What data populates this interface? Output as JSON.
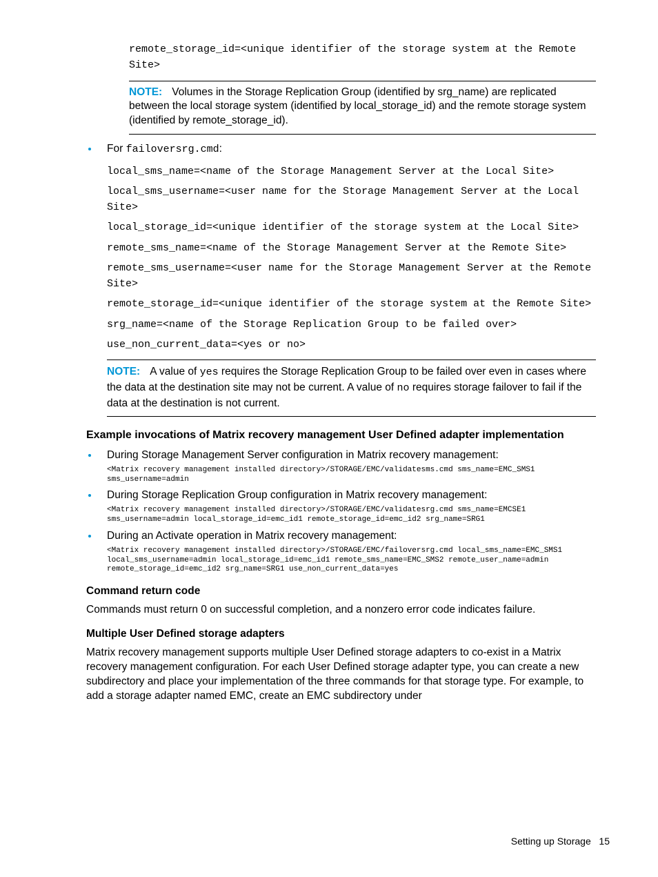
{
  "top_code": "remote_storage_id=<unique identifier of the storage system at the Remote Site>",
  "note1": {
    "label": "NOTE:",
    "text": "Volumes in the Storage Replication Group (identified by srg_name) are replicated between the local storage system (identified by local_storage_id) and the remote storage system (identified by remote_storage_id)."
  },
  "bullet1_prefix": "For ",
  "bullet1_code": "failoversrg.cmd",
  "bullet1_suffix": ":",
  "failover_lines": [
    "local_sms_name=<name of the Storage Management Server at the Local Site>",
    "local_sms_username=<user name for the Storage Management Server at the Local Site>",
    "local_storage_id=<unique identifier of the storage system at the Local Site>",
    "remote_sms_name=<name of the Storage Management Server at the Remote Site>",
    "remote_sms_username=<user name for the Storage Management Server at the Remote Site>",
    "remote_storage_id=<unique identifier of the storage system at the Remote Site>",
    "srg_name=<name of the Storage Replication Group to be failed over>",
    "use_non_current_data=<yes or no>"
  ],
  "note2": {
    "label": "NOTE:",
    "pre": "A value of ",
    "c1": "yes",
    "mid": " requires the Storage Replication Group to be failed over even in cases where the data at the destination site may not be current. A value of ",
    "c2": "no",
    "post": " requires storage failover to fail if the data at the destination is not current."
  },
  "examples_heading": "Example invocations of Matrix recovery management User Defined adapter implementation",
  "examples": [
    {
      "text": "During Storage Management Server configuration in Matrix recovery management:",
      "code": "<Matrix recovery management installed directory>/STORAGE/EMC/validatesms.cmd sms_name=EMC_SMS1 sms_username=admin"
    },
    {
      "text": "During Storage Replication Group configuration in Matrix recovery management:",
      "code": "<Matrix recovery management installed directory>/STORAGE/EMC/validatesrg.cmd sms_name=EMCSE1 sms_username=admin local_storage_id=emc_id1 remote_storage_id=emc_id2 srg_name=SRG1"
    },
    {
      "text": "During an Activate operation in Matrix recovery management:",
      "code": "<Matrix recovery management installed directory>/STORAGE/EMC/failoversrg.cmd local_sms_name=EMC_SMS1 local_sms_username=admin local_storage_id=emc_id1 remote_sms_name=EMC_SMS2 remote_user_name=admin remote_storage_id=emc_id2 srg_name=SRG1 use_non_current_data=yes"
    }
  ],
  "cmd_return_heading": "Command return code",
  "cmd_return_text": "Commands must return 0 on successful completion, and a nonzero error code indicates failure.",
  "multi_heading": "Multiple User Defined storage adapters",
  "multi_text": "Matrix recovery management supports multiple User Defined storage adapters to co-exist in a Matrix recovery management configuration. For each User Defined storage adapter type, you can create a new subdirectory and place your implementation of the three commands for that storage type. For example, to add a storage adapter named EMC, create an EMC subdirectory under",
  "footer_text": "Setting up Storage",
  "footer_page": "15"
}
